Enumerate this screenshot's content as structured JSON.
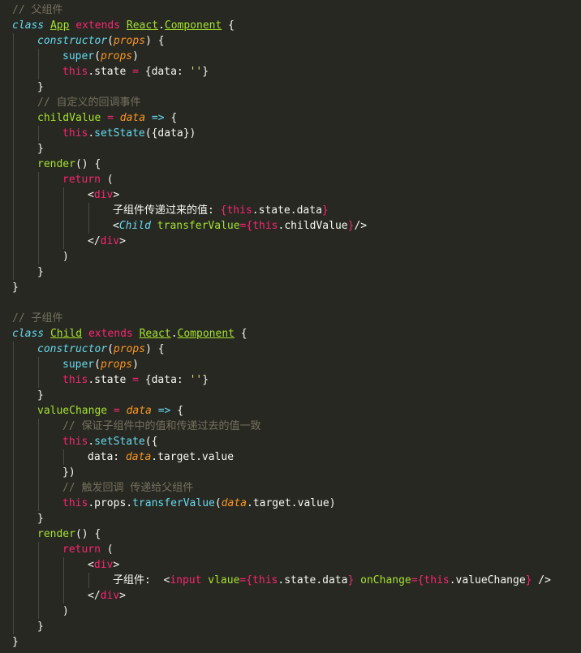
{
  "colors": {
    "background": "#272822",
    "foreground": "#f8f8f2",
    "comment": "#75715e",
    "keyword": "#66d9ef",
    "class_name": "#a6e22e",
    "pink": "#f92672",
    "param": "#fd971f",
    "string": "#e6db74",
    "indent_guide": "#4a4a44"
  },
  "lines": [
    {
      "indent": 0,
      "tokens": [
        {
          "t": "cm",
          "v": "// 父组件"
        }
      ]
    },
    {
      "indent": 0,
      "tokens": [
        {
          "t": "kw",
          "v": "class"
        },
        {
          "t": "p",
          "v": " "
        },
        {
          "t": "cls",
          "v": "App"
        },
        {
          "t": "p",
          "v": " "
        },
        {
          "t": "ext",
          "v": "extends"
        },
        {
          "t": "p",
          "v": " "
        },
        {
          "t": "cls",
          "v": "React"
        },
        {
          "t": "p",
          "v": "."
        },
        {
          "t": "cls",
          "v": "Component"
        },
        {
          "t": "p",
          "v": " {"
        }
      ]
    },
    {
      "indent": 1,
      "tokens": [
        {
          "t": "kw",
          "v": "constructor"
        },
        {
          "t": "p",
          "v": "("
        },
        {
          "t": "prm",
          "v": "props"
        },
        {
          "t": "p",
          "v": ") {"
        }
      ]
    },
    {
      "indent": 2,
      "tokens": [
        {
          "t": "sup",
          "v": "super"
        },
        {
          "t": "p",
          "v": "("
        },
        {
          "t": "prm",
          "v": "props"
        },
        {
          "t": "p",
          "v": ")"
        }
      ]
    },
    {
      "indent": 2,
      "tokens": [
        {
          "t": "this",
          "v": "this"
        },
        {
          "t": "p",
          "v": ".state "
        },
        {
          "t": "op",
          "v": "="
        },
        {
          "t": "p",
          "v": " {data: "
        },
        {
          "t": "str",
          "v": "''"
        },
        {
          "t": "p",
          "v": "}"
        }
      ]
    },
    {
      "indent": 1,
      "tokens": [
        {
          "t": "p",
          "v": "}"
        }
      ]
    },
    {
      "indent": 1,
      "tokens": [
        {
          "t": "cm",
          "v": "// 自定义的回调事件"
        }
      ]
    },
    {
      "indent": 1,
      "tokens": [
        {
          "t": "fn",
          "v": "childValue"
        },
        {
          "t": "p",
          "v": " "
        },
        {
          "t": "op",
          "v": "="
        },
        {
          "t": "p",
          "v": " "
        },
        {
          "t": "prm",
          "v": "data"
        },
        {
          "t": "p",
          "v": " "
        },
        {
          "t": "arrow",
          "v": "=>"
        },
        {
          "t": "p",
          "v": " {"
        }
      ]
    },
    {
      "indent": 2,
      "tokens": [
        {
          "t": "this",
          "v": "this"
        },
        {
          "t": "p",
          "v": "."
        },
        {
          "t": "sup",
          "v": "setState"
        },
        {
          "t": "p",
          "v": "({data})"
        }
      ]
    },
    {
      "indent": 1,
      "tokens": [
        {
          "t": "p",
          "v": "}"
        }
      ]
    },
    {
      "indent": 1,
      "tokens": [
        {
          "t": "fn",
          "v": "render"
        },
        {
          "t": "p",
          "v": "() {"
        }
      ]
    },
    {
      "indent": 2,
      "tokens": [
        {
          "t": "ext",
          "v": "return"
        },
        {
          "t": "p",
          "v": " ("
        }
      ]
    },
    {
      "indent": 3,
      "tokens": [
        {
          "t": "p",
          "v": "<"
        },
        {
          "t": "tag",
          "v": "div"
        },
        {
          "t": "p",
          "v": ">"
        }
      ]
    },
    {
      "indent": 4,
      "tokens": [
        {
          "t": "txt",
          "v": "子组件传递过来的值: "
        },
        {
          "t": "br",
          "v": "{"
        },
        {
          "t": "this",
          "v": "this"
        },
        {
          "t": "p",
          "v": ".state.data"
        },
        {
          "t": "br",
          "v": "}"
        }
      ]
    },
    {
      "indent": 4,
      "tokens": [
        {
          "t": "p",
          "v": "<"
        },
        {
          "t": "comp",
          "v": "Child"
        },
        {
          "t": "p",
          "v": " "
        },
        {
          "t": "attr",
          "v": "transferValue"
        },
        {
          "t": "op",
          "v": "="
        },
        {
          "t": "br",
          "v": "{"
        },
        {
          "t": "this",
          "v": "this"
        },
        {
          "t": "p",
          "v": ".childValue"
        },
        {
          "t": "br",
          "v": "}"
        },
        {
          "t": "p",
          "v": "/>"
        }
      ]
    },
    {
      "indent": 3,
      "tokens": [
        {
          "t": "p",
          "v": "</"
        },
        {
          "t": "tag",
          "v": "div"
        },
        {
          "t": "p",
          "v": ">"
        }
      ]
    },
    {
      "indent": 2,
      "tokens": [
        {
          "t": "p",
          "v": ")"
        }
      ]
    },
    {
      "indent": 1,
      "tokens": [
        {
          "t": "p",
          "v": "}"
        }
      ]
    },
    {
      "indent": 0,
      "tokens": [
        {
          "t": "p",
          "v": "}"
        }
      ]
    },
    {
      "indent": 0,
      "tokens": []
    },
    {
      "indent": 0,
      "tokens": [
        {
          "t": "cm",
          "v": "// 子组件"
        }
      ]
    },
    {
      "indent": 0,
      "tokens": [
        {
          "t": "kw",
          "v": "class"
        },
        {
          "t": "p",
          "v": " "
        },
        {
          "t": "cls",
          "v": "Child"
        },
        {
          "t": "p",
          "v": " "
        },
        {
          "t": "ext",
          "v": "extends"
        },
        {
          "t": "p",
          "v": " "
        },
        {
          "t": "cls",
          "v": "React"
        },
        {
          "t": "p",
          "v": "."
        },
        {
          "t": "cls",
          "v": "Component"
        },
        {
          "t": "p",
          "v": " {"
        }
      ]
    },
    {
      "indent": 1,
      "tokens": [
        {
          "t": "kw",
          "v": "constructor"
        },
        {
          "t": "p",
          "v": "("
        },
        {
          "t": "prm",
          "v": "props"
        },
        {
          "t": "p",
          "v": ") {"
        }
      ]
    },
    {
      "indent": 2,
      "tokens": [
        {
          "t": "sup",
          "v": "super"
        },
        {
          "t": "p",
          "v": "("
        },
        {
          "t": "prm",
          "v": "props"
        },
        {
          "t": "p",
          "v": ")"
        }
      ]
    },
    {
      "indent": 2,
      "tokens": [
        {
          "t": "this",
          "v": "this"
        },
        {
          "t": "p",
          "v": ".state "
        },
        {
          "t": "op",
          "v": "="
        },
        {
          "t": "p",
          "v": " {data: "
        },
        {
          "t": "str",
          "v": "''"
        },
        {
          "t": "p",
          "v": "}"
        }
      ]
    },
    {
      "indent": 1,
      "tokens": [
        {
          "t": "p",
          "v": "}"
        }
      ]
    },
    {
      "indent": 1,
      "tokens": [
        {
          "t": "fn",
          "v": "valueChange"
        },
        {
          "t": "p",
          "v": " "
        },
        {
          "t": "op",
          "v": "="
        },
        {
          "t": "p",
          "v": " "
        },
        {
          "t": "prm",
          "v": "data"
        },
        {
          "t": "p",
          "v": " "
        },
        {
          "t": "arrow",
          "v": "=>"
        },
        {
          "t": "p",
          "v": " {"
        }
      ]
    },
    {
      "indent": 2,
      "tokens": [
        {
          "t": "cm",
          "v": "// 保证子组件中的值和传递过去的值一致"
        }
      ]
    },
    {
      "indent": 2,
      "tokens": [
        {
          "t": "this",
          "v": "this"
        },
        {
          "t": "p",
          "v": "."
        },
        {
          "t": "sup",
          "v": "setState"
        },
        {
          "t": "p",
          "v": "({"
        }
      ]
    },
    {
      "indent": 3,
      "tokens": [
        {
          "t": "p",
          "v": "data: "
        },
        {
          "t": "prm",
          "v": "data"
        },
        {
          "t": "p",
          "v": ".target.value"
        }
      ]
    },
    {
      "indent": 2,
      "tokens": [
        {
          "t": "p",
          "v": "})"
        }
      ]
    },
    {
      "indent": 2,
      "tokens": [
        {
          "t": "cm",
          "v": "// 触发回调 传递给父组件"
        }
      ]
    },
    {
      "indent": 2,
      "tokens": [
        {
          "t": "this",
          "v": "this"
        },
        {
          "t": "p",
          "v": ".props."
        },
        {
          "t": "sup",
          "v": "transferValue"
        },
        {
          "t": "p",
          "v": "("
        },
        {
          "t": "prm",
          "v": "data"
        },
        {
          "t": "p",
          "v": ".target.value)"
        }
      ]
    },
    {
      "indent": 1,
      "tokens": [
        {
          "t": "p",
          "v": "}"
        }
      ]
    },
    {
      "indent": 1,
      "tokens": [
        {
          "t": "fn",
          "v": "render"
        },
        {
          "t": "p",
          "v": "() {"
        }
      ]
    },
    {
      "indent": 2,
      "tokens": [
        {
          "t": "ext",
          "v": "return"
        },
        {
          "t": "p",
          "v": " ("
        }
      ]
    },
    {
      "indent": 3,
      "tokens": [
        {
          "t": "p",
          "v": "<"
        },
        {
          "t": "tag",
          "v": "div"
        },
        {
          "t": "p",
          "v": ">"
        }
      ]
    },
    {
      "indent": 4,
      "tokens": [
        {
          "t": "txt",
          "v": "子组件:  "
        },
        {
          "t": "p",
          "v": "<"
        },
        {
          "t": "tag",
          "v": "input"
        },
        {
          "t": "p",
          "v": " "
        },
        {
          "t": "attr",
          "v": "vlaue"
        },
        {
          "t": "op",
          "v": "="
        },
        {
          "t": "br",
          "v": "{"
        },
        {
          "t": "this",
          "v": "this"
        },
        {
          "t": "p",
          "v": ".state.data"
        },
        {
          "t": "br",
          "v": "}"
        },
        {
          "t": "p",
          "v": " "
        },
        {
          "t": "attr",
          "v": "onChange"
        },
        {
          "t": "op",
          "v": "="
        },
        {
          "t": "br",
          "v": "{"
        },
        {
          "t": "this",
          "v": "this"
        },
        {
          "t": "p",
          "v": ".valueChange"
        },
        {
          "t": "br",
          "v": "}"
        },
        {
          "t": "p",
          "v": " />"
        }
      ]
    },
    {
      "indent": 3,
      "tokens": [
        {
          "t": "p",
          "v": "</"
        },
        {
          "t": "tag",
          "v": "div"
        },
        {
          "t": "p",
          "v": ">"
        }
      ]
    },
    {
      "indent": 2,
      "tokens": [
        {
          "t": "p",
          "v": ")"
        }
      ]
    },
    {
      "indent": 1,
      "tokens": [
        {
          "t": "p",
          "v": "}"
        }
      ]
    },
    {
      "indent": 0,
      "tokens": [
        {
          "t": "p",
          "v": "}"
        }
      ]
    }
  ]
}
